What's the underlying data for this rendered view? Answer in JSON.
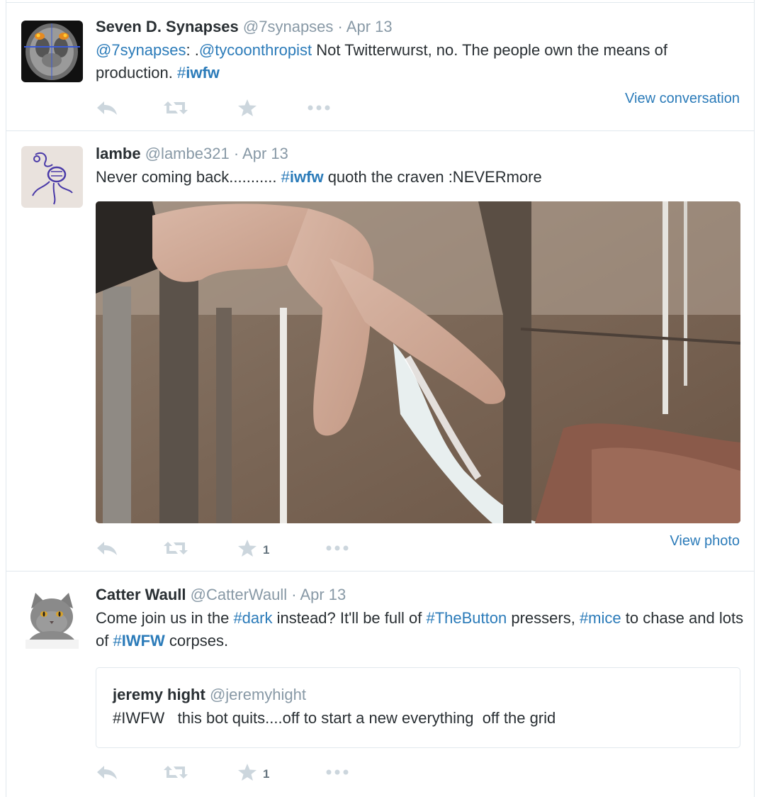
{
  "tweets": [
    {
      "fullname": "Seven D. Synapses",
      "handle": "@7synapses",
      "sep": "·",
      "time": "Apr 13",
      "text_parts": [
        "@7synapses",
        ": .",
        "@tycoonthropist",
        " Not Twitterwurst, no. The people own the means of production. ",
        "#",
        "iwfw"
      ],
      "favorite_count": "",
      "side_link": "View conversation"
    },
    {
      "fullname": "lambe",
      "handle": "@lambe321",
      "sep": "·",
      "time": "Apr 13",
      "text_parts": [
        "Never coming back........... ",
        "#",
        "iwfw",
        " quoth the craven :NEVERmore"
      ],
      "favorite_count": "1",
      "side_link": "View photo"
    },
    {
      "fullname": "Catter Waull",
      "handle": "@CatterWaull",
      "sep": "·",
      "time": "Apr 13",
      "text_parts": [
        "Come join us in the ",
        "#dark",
        " instead? It'll be full of ",
        "#TheButton",
        " pressers, ",
        "#mice",
        " to chase and lots of ",
        "#",
        "IWFW",
        " corpses."
      ],
      "favorite_count": "1",
      "quoted": {
        "fullname": "jeremy hight",
        "handle": "@jeremyhight",
        "text": "#IWFW   this bot quits....off to start a new everything  off the grid"
      }
    }
  ],
  "icons": [
    "reply-icon",
    "retweet-icon",
    "favorite-icon",
    "more-icon"
  ],
  "colors": {
    "link": "#2b7bb9",
    "muted": "#8899a6",
    "icon": "#ccd6dd",
    "border": "#e1e8ed",
    "text": "#292f33"
  }
}
